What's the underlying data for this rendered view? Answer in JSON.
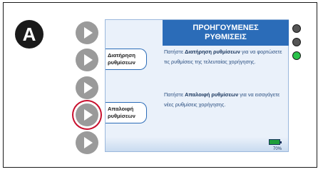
{
  "step": {
    "letter": "A"
  },
  "screen": {
    "header": {
      "line1": "ΠΡΟΗΓΟΥΜΕΝΕΣ",
      "line2": "ΡΥΘΜΙΣΕΙΣ"
    },
    "tabs": [
      {
        "line1": "Διατήρηση",
        "line2": "ρυθμίσεων"
      },
      {
        "line1": "Απαλοιφή",
        "line2": "ρυθμίσεων"
      }
    ],
    "text1": {
      "pre": "Πατήστε ",
      "bold": "Διατήρηση ρυθμίσεων",
      "post": " για να φορτώσετε τις ρυθμίσεις της τελευταίας χορήγησης."
    },
    "text2": {
      "pre": "Πατήστε ",
      "bold": "Απαλοιφή ρυθμίσεων",
      "post": " για να εισαγάγετε νέες ρυθμίσεις χορήγησης."
    },
    "battery": {
      "label": "70%",
      "level": 0.7,
      "color": "#1f9e3a"
    }
  },
  "side_buttons": [
    {
      "icon": "play-icon",
      "selected": false
    },
    {
      "icon": "play-icon",
      "selected": false
    },
    {
      "icon": "play-icon",
      "selected": false
    },
    {
      "icon": "play-icon",
      "selected": true
    },
    {
      "icon": "play-icon",
      "selected": false
    }
  ],
  "indicators": [
    {
      "state": "off",
      "color": "#555555"
    },
    {
      "state": "off",
      "color": "#555555"
    },
    {
      "state": "on",
      "color": "#29c24a"
    }
  ]
}
